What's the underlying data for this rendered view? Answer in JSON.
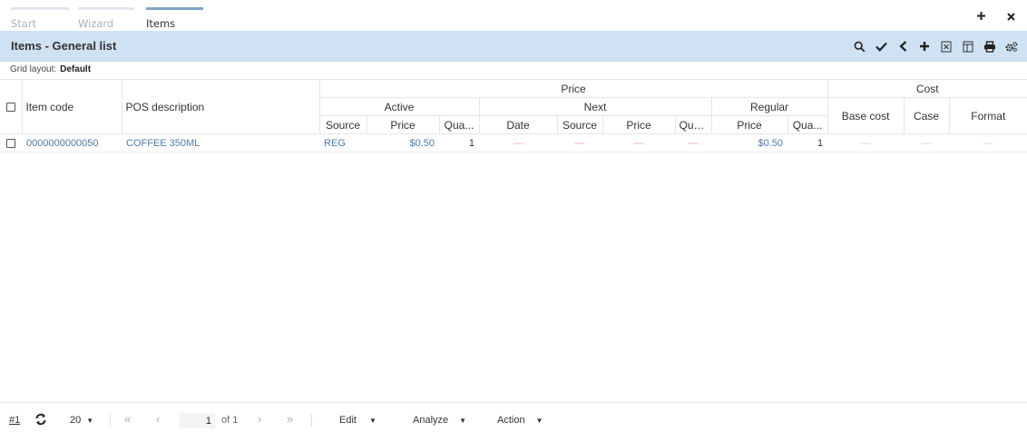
{
  "tabs": [
    {
      "label": "Start",
      "active": false
    },
    {
      "label": "Wizard",
      "active": false
    },
    {
      "label": "Items",
      "active": true
    }
  ],
  "window": {
    "add_icon": "plus-icon",
    "close_icon": "close-icon"
  },
  "title": "Items - General list",
  "toolbar_icons": [
    "search-icon",
    "check-icon",
    "back-icon",
    "add-icon",
    "excel-export-icon",
    "column-settings-icon",
    "print-icon",
    "settings-icon"
  ],
  "grid_layout": {
    "label": "Grid layout:",
    "value": "Default"
  },
  "grid": {
    "group_headers": {
      "price": "Price",
      "cost": "Cost"
    },
    "sub_headers": {
      "active": "Active",
      "next": "Next",
      "regular": "Regular"
    },
    "columns": {
      "item_code": "Item code",
      "pos_description": "POS description",
      "active_source": "Source",
      "active_price": "Price",
      "active_qty": "Qua...",
      "next_date": "Date",
      "next_source": "Source",
      "next_price": "Price",
      "next_qty": "Qua...",
      "regular_price": "Price",
      "regular_qty": "Qua...",
      "base_cost": "Base cost",
      "case": "Case",
      "format": "Format"
    },
    "rows": [
      {
        "item_code": "0000000000050",
        "pos_description": "COFFEE 350ML",
        "active_source": "REG",
        "active_price": "$0.50",
        "active_qty": "1",
        "next_date": "—",
        "next_source": "—",
        "next_price": "—",
        "next_qty": "—",
        "regular_price": "$0.50",
        "regular_qty": "1",
        "base_cost": "—",
        "case": "—",
        "format": "—"
      }
    ]
  },
  "footer": {
    "record_link": "#1",
    "page_size": "20",
    "page": "1",
    "of_label": "of 1",
    "menus": {
      "edit": "Edit",
      "analyze": "Analyze",
      "action": "Action"
    }
  }
}
